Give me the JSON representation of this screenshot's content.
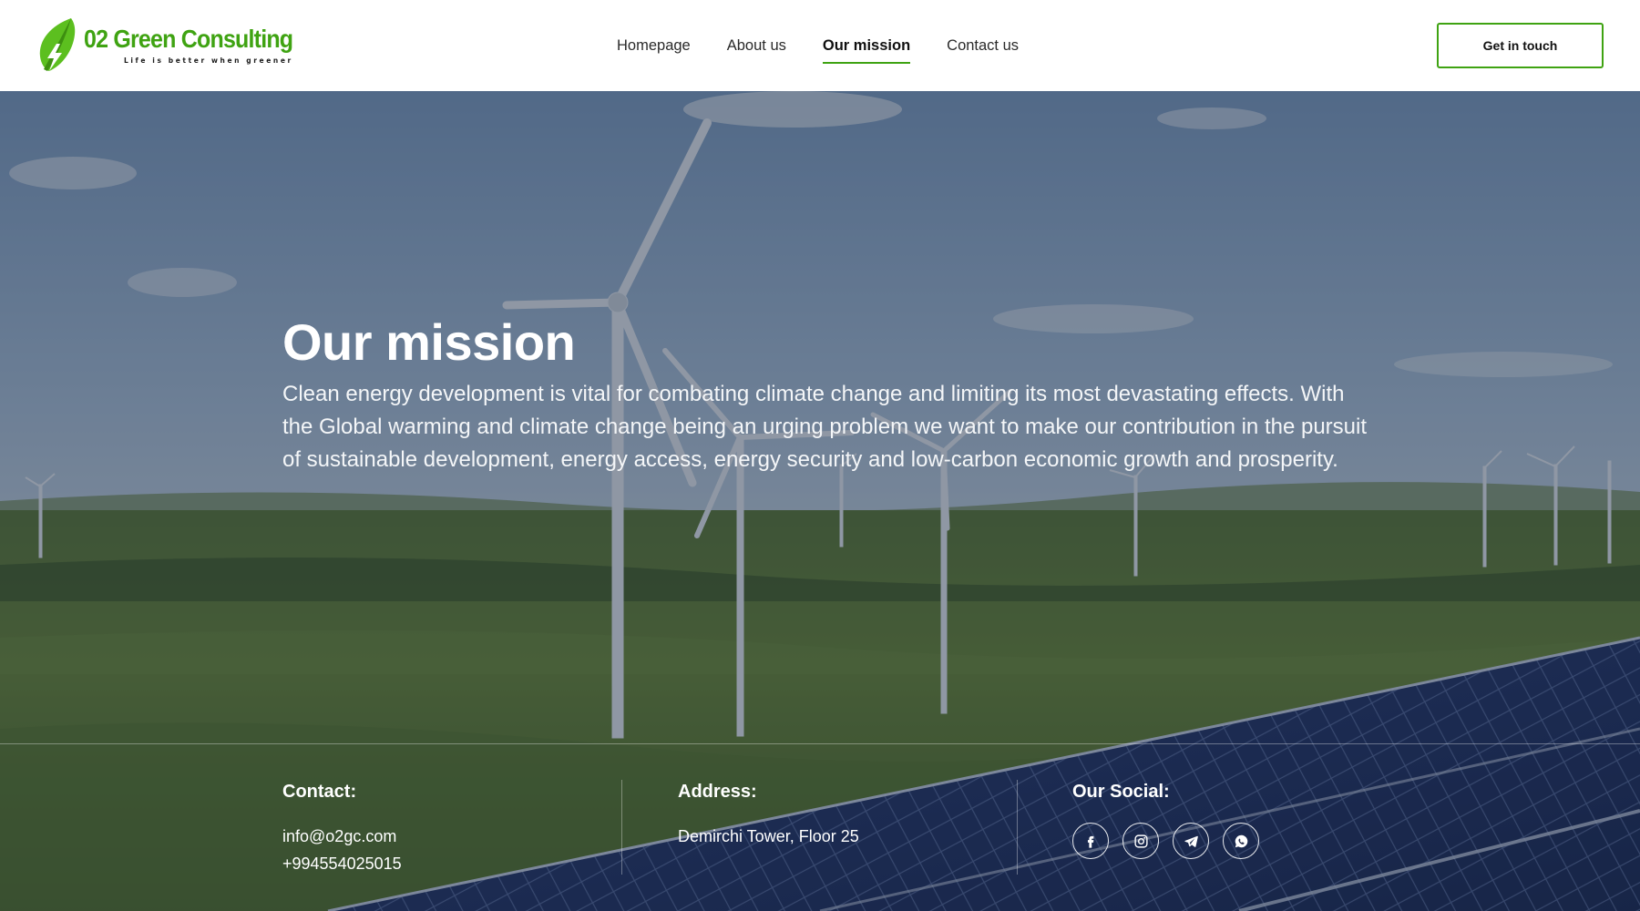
{
  "brand": {
    "name": "02 Green Consulting",
    "tagline": "Life is better when greener",
    "color": "#3fa312"
  },
  "nav": {
    "items": [
      {
        "label": "Homepage",
        "active": false
      },
      {
        "label": "About us",
        "active": false
      },
      {
        "label": "Our mission",
        "active": true
      },
      {
        "label": "Contact us",
        "active": false
      }
    ],
    "cta_label": "Get in touch"
  },
  "hero": {
    "title": "Our mission",
    "text": "Clean energy development is vital for combating climate change and limiting its most devastating effects. With the Global warming and climate change being an urging problem we want to make our contribution in the pursuit of sustainable development, energy access, energy security and low-carbon economic growth and prosperity."
  },
  "footer": {
    "contact": {
      "heading": "Contact:",
      "email": "info@o2gc.com",
      "phone": "+994554025015"
    },
    "address": {
      "heading": "Address:",
      "line": "Demirchi Tower, Floor 25"
    },
    "social": {
      "heading": "Our Social:",
      "icons": [
        "facebook-icon",
        "instagram-icon",
        "telegram-icon",
        "whatsapp-icon"
      ]
    }
  }
}
